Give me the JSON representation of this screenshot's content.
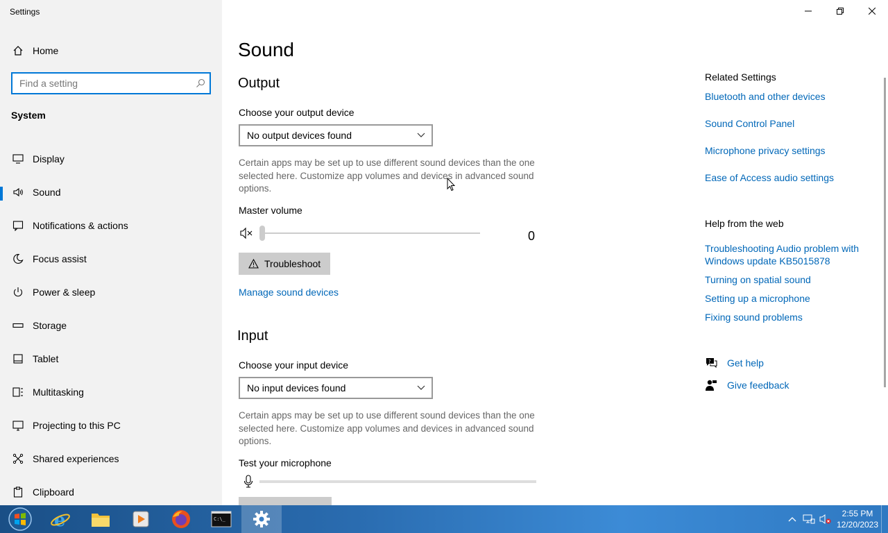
{
  "window": {
    "title": "Settings"
  },
  "sidebar": {
    "home_label": "Home",
    "search_placeholder": "Find a setting",
    "section_label": "System",
    "items": [
      {
        "label": "Display",
        "icon": "display-icon"
      },
      {
        "label": "Sound",
        "icon": "speaker-icon",
        "active": true
      },
      {
        "label": "Notifications & actions",
        "icon": "notifications-icon"
      },
      {
        "label": "Focus assist",
        "icon": "moon-icon"
      },
      {
        "label": "Power & sleep",
        "icon": "power-icon"
      },
      {
        "label": "Storage",
        "icon": "storage-icon"
      },
      {
        "label": "Tablet",
        "icon": "tablet-icon"
      },
      {
        "label": "Multitasking",
        "icon": "multitasking-icon"
      },
      {
        "label": "Projecting to this PC",
        "icon": "projecting-icon"
      },
      {
        "label": "Shared experiences",
        "icon": "shared-experiences-icon"
      },
      {
        "label": "Clipboard",
        "icon": "clipboard-icon"
      }
    ]
  },
  "main": {
    "title": "Sound",
    "output": {
      "heading": "Output",
      "choose_label": "Choose your output device",
      "device_value": "No output devices found",
      "description": "Certain apps may be set up to use different sound devices than the one selected here. Customize app volumes and devices in advanced sound options.",
      "volume_label": "Master volume",
      "volume_value": "0",
      "troubleshoot_label": "Troubleshoot",
      "manage_link": "Manage sound devices"
    },
    "input": {
      "heading": "Input",
      "choose_label": "Choose your input device",
      "device_value": "No input devices found",
      "description": "Certain apps may be set up to use different sound devices than the one selected here. Customize app volumes and devices in advanced sound options.",
      "test_label": "Test your microphone"
    }
  },
  "related": {
    "heading": "Related Settings",
    "links": [
      "Bluetooth and other devices",
      "Sound Control Panel",
      "Microphone privacy settings",
      "Ease of Access audio settings"
    ],
    "help_heading": "Help from the web",
    "help_links": [
      "Troubleshooting Audio problem with Windows update KB5015878",
      "Turning on spatial sound",
      "Setting up a microphone",
      "Fixing sound problems"
    ],
    "get_help": "Get help",
    "give_feedback": "Give feedback"
  },
  "taskbar": {
    "time": "2:55 PM",
    "date": "12/20/2023",
    "apps": [
      "internet-explorer-icon",
      "file-explorer-icon",
      "media-player-icon",
      "firefox-icon",
      "command-prompt-icon",
      "settings-gear-icon"
    ]
  },
  "colors": {
    "accent": "#0078d7",
    "link": "#0067b8",
    "sidebar_bg": "#f2f2f2"
  }
}
